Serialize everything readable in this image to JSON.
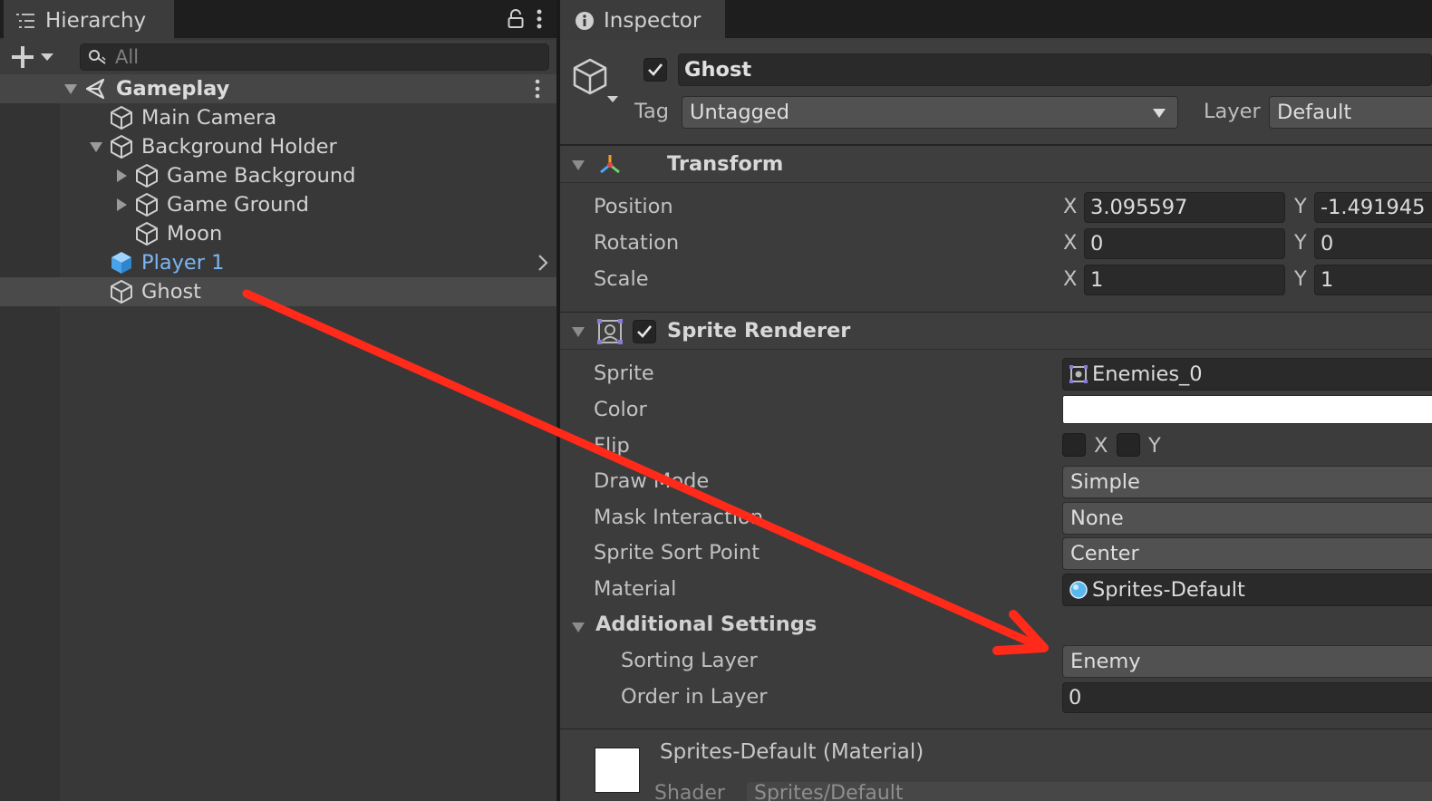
{
  "hierarchy": {
    "tab_label": "Hierarchy",
    "search_placeholder": "All",
    "scene": "Gameplay",
    "items": [
      {
        "label": "Main Camera"
      },
      {
        "label": "Background Holder"
      },
      {
        "label": "Game Background"
      },
      {
        "label": "Game Ground"
      },
      {
        "label": "Moon"
      },
      {
        "label": "Player 1"
      },
      {
        "label": "Ghost"
      }
    ]
  },
  "inspector": {
    "tab_label": "Inspector",
    "object_name": "Ghost",
    "tag_label": "Tag",
    "tag_value": "Untagged",
    "layer_label": "Layer",
    "layer_value": "Default",
    "transform": {
      "title": "Transform",
      "position_label": "Position",
      "rotation_label": "Rotation",
      "scale_label": "Scale",
      "x_letter": "X",
      "y_letter": "Y",
      "position": {
        "x": "3.095597",
        "y": "-1.491945"
      },
      "rotation": {
        "x": "0",
        "y": "0"
      },
      "scale": {
        "x": "1",
        "y": "1"
      }
    },
    "sprite_renderer": {
      "title": "Sprite Renderer",
      "sprite_label": "Sprite",
      "sprite_value": "Enemies_0",
      "color_label": "Color",
      "color_value": "#ffffff",
      "flip_label": "Flip",
      "flip_x": "X",
      "flip_y": "Y",
      "draw_mode_label": "Draw Mode",
      "draw_mode_value": "Simple",
      "mask_label": "Mask Interaction",
      "mask_value": "None",
      "sort_point_label": "Sprite Sort Point",
      "sort_point_value": "Center",
      "material_label": "Material",
      "material_value": "Sprites-Default",
      "additional_settings": "Additional Settings",
      "sorting_layer_label": "Sorting Layer",
      "sorting_layer_value": "Enemy",
      "order_label": "Order in Layer",
      "order_value": "0"
    },
    "material_section": {
      "title": "Sprites-Default (Material)",
      "shader_label": "Shader",
      "shader_value": "Sprites/Default"
    }
  },
  "colors": {
    "selected_text": "#7cb5f5",
    "arrow": "#ff2a1a"
  }
}
